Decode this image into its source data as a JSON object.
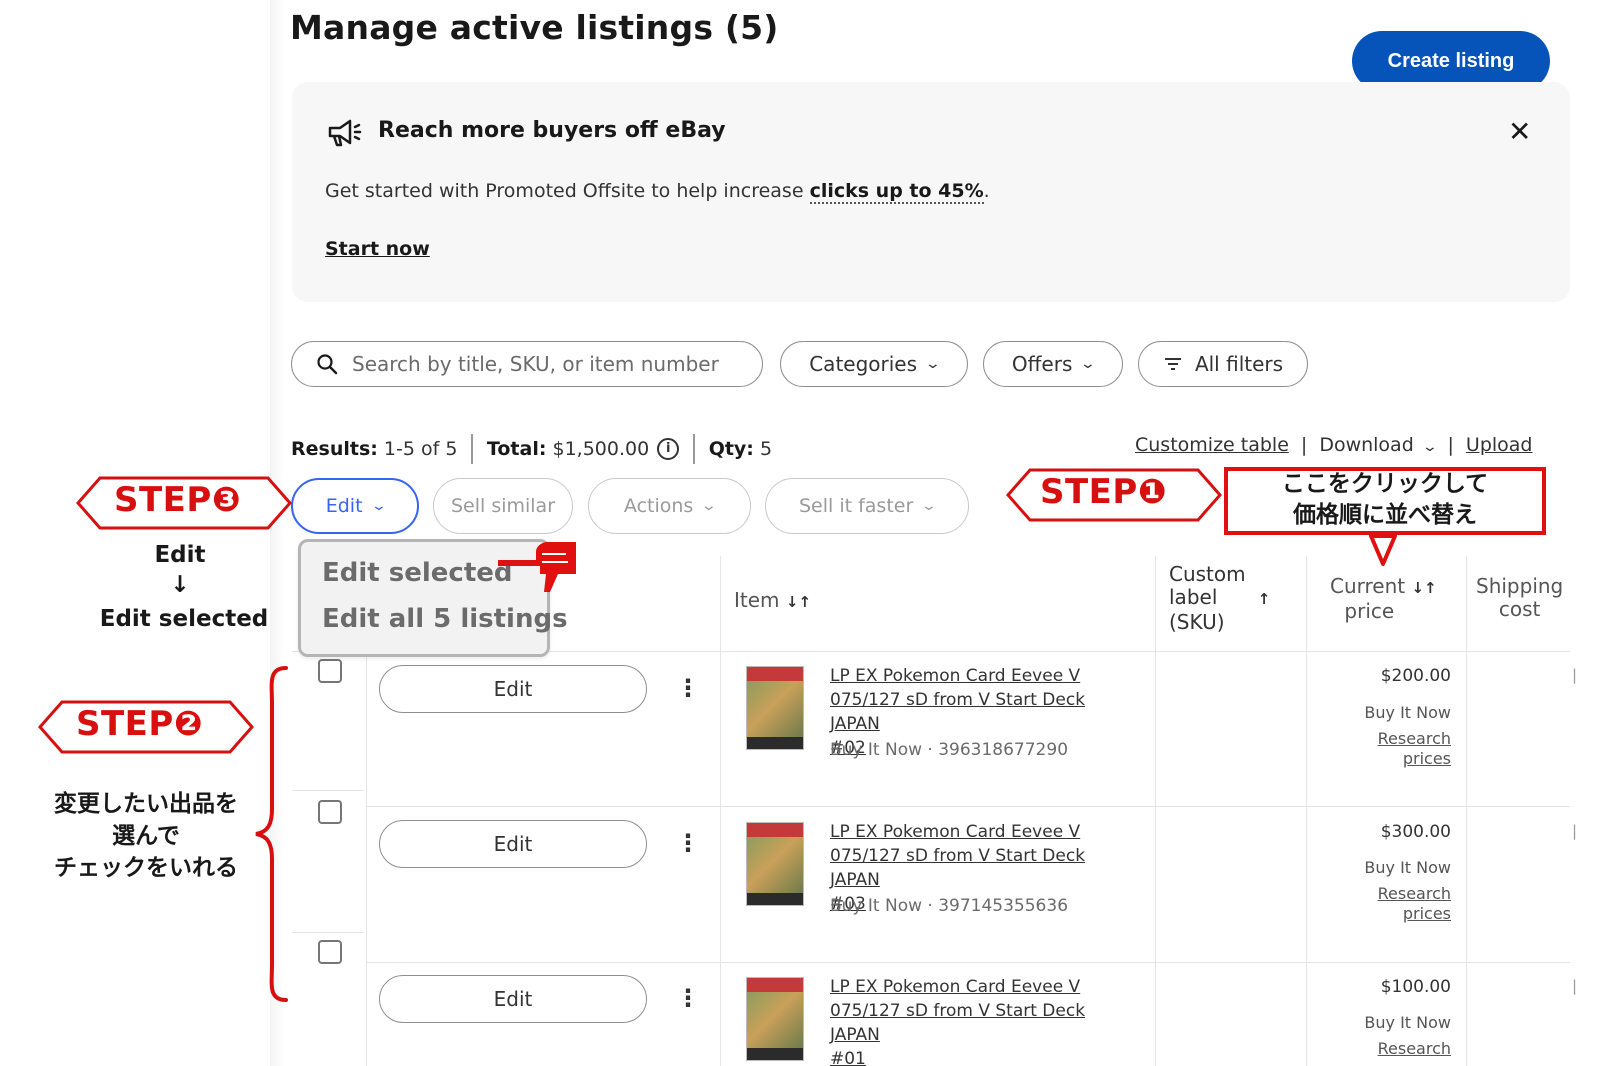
{
  "header": {
    "title": "Manage active listings (5)",
    "create_label": "Create listing"
  },
  "promo": {
    "title": "Reach more buyers off eBay",
    "text_prefix": "Get started with Promoted Offsite to help increase ",
    "text_bold": "clicks up to 45%",
    "text_suffix": ".",
    "link": "Start now",
    "close": "✕"
  },
  "filters": {
    "search_placeholder": "Search by title, SKU, or item number",
    "categories": "Categories",
    "offers": "Offers",
    "all_filters": "All filters"
  },
  "summary": {
    "results_label": "Results:",
    "results_value": "1-5 of 5",
    "total_label": "Total:",
    "total_value": "$1,500.00",
    "qty_label": "Qty:",
    "qty_value": "5",
    "customize": "Customize table",
    "download": "Download",
    "upload": "Upload"
  },
  "actions": {
    "edit": "Edit",
    "sell_similar": "Sell similar",
    "actions": "Actions",
    "sell_faster": "Sell it faster"
  },
  "edit_menu": {
    "edit_selected": "Edit selected",
    "edit_all": "Edit all 5 listings"
  },
  "table": {
    "col_item": "Item",
    "col_sku_1": "Custom",
    "col_sku_2": "label",
    "col_sku_3": "(SKU)",
    "col_price_1": "Current",
    "col_price_2": "price",
    "col_ship_1": "Shipping",
    "col_ship_2": "cost",
    "rows": [
      {
        "edit": "Edit",
        "title_1": "LP EX Pokemon Card Eevee V",
        "title_2": "075/127 sD from V Start Deck JAPAN",
        "title_3": "#02",
        "sub": "Buy It Now · 396318677290",
        "price": "$200.00",
        "format": "Buy It Now",
        "research_1": "Research",
        "research_2": "prices"
      },
      {
        "edit": "Edit",
        "title_1": "LP EX Pokemon Card Eevee V",
        "title_2": "075/127 sD from V Start Deck JAPAN",
        "title_3": "#03",
        "sub": "Buy It Now · 397145355636",
        "price": "$300.00",
        "format": "Buy It Now",
        "research_1": "Research",
        "research_2": "prices"
      },
      {
        "edit": "Edit",
        "title_1": "LP EX Pokemon Card Eevee V",
        "title_2": "075/127 sD from V Start Deck JAPAN",
        "title_3": "#01",
        "price": "$100.00",
        "format": "Buy It Now",
        "research_1": "Research"
      }
    ]
  },
  "annotations": {
    "step1": "STEP❶",
    "step1_note_1": "ここをクリックして",
    "step1_note_2": "価格順に並べ替え",
    "step2": "STEP❷",
    "step2_note_1": "変更したい出品を",
    "step2_note_2": "選んで",
    "step2_note_3": "チェックをいれる",
    "step3": "STEP❸",
    "step3_note_1": "Edit",
    "step3_arrow": "↓",
    "step3_note_2": "Edit selected",
    "accent_color": "#d80f0f"
  }
}
